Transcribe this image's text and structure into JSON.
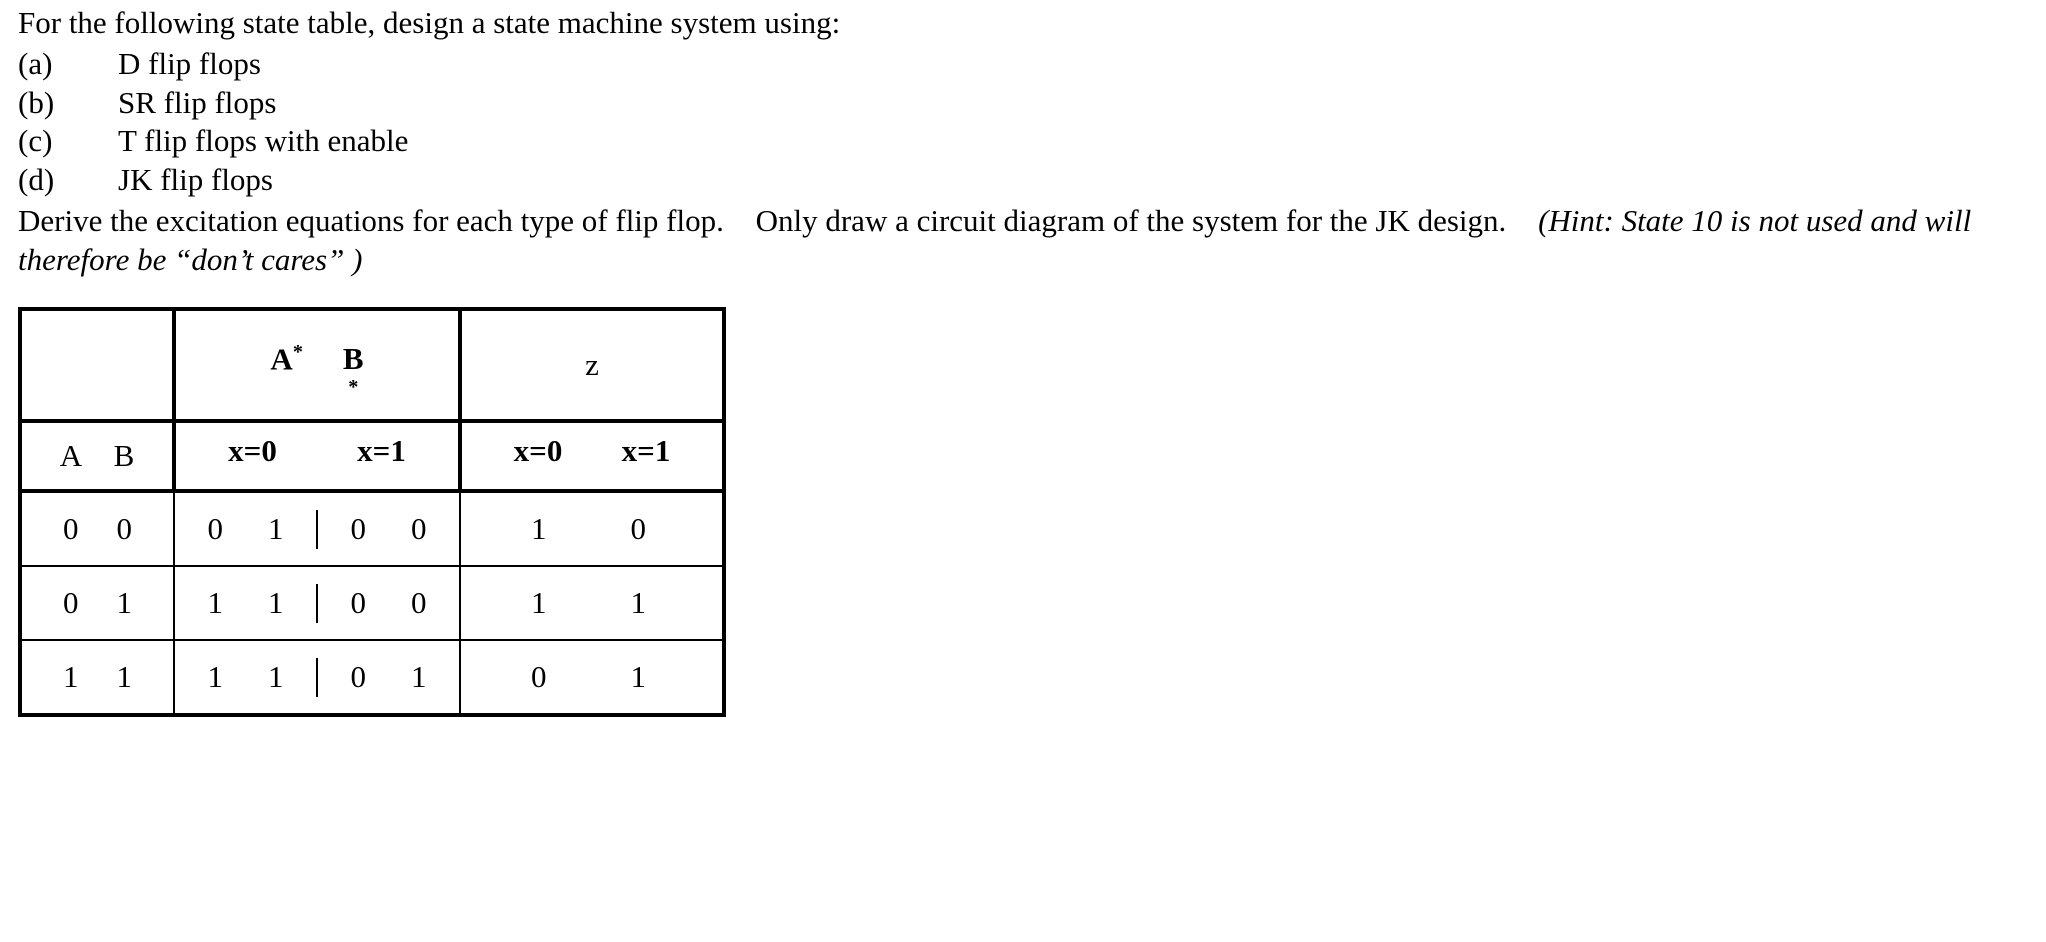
{
  "intro": "For the following state table, design a state machine system using:",
  "options": [
    {
      "label": "(a)",
      "text": "D flip flops"
    },
    {
      "label": "(b)",
      "text": "SR flip flops"
    },
    {
      "label": "(c)",
      "text": "T flip flops with enable"
    },
    {
      "label": "(d)",
      "text": "JK flip flops"
    }
  ],
  "instruction_part1": "Derive the excitation equations for each type of flip flop.",
  "instruction_part2": "Only draw a circuit diagram of the system for the JK design.",
  "hint": "(Hint: State 10 is not used and will therefore be “don’t cares” )",
  "headers": {
    "A_label": "A",
    "B_label": "B",
    "A_star": "A",
    "A_star_sup": "*",
    "B_sym": "B",
    "B_star_sub": "*",
    "z_label": "z",
    "x0": "x=0",
    "x1": "x=1"
  },
  "rows": [
    {
      "A": "0",
      "B": "0",
      "next_x0_A": "0",
      "next_x0_B": "1",
      "next_x1_A": "0",
      "next_x1_B": "0",
      "z_x0": "1",
      "z_x1": "0"
    },
    {
      "A": "0",
      "B": "1",
      "next_x0_A": "1",
      "next_x0_B": "1",
      "next_x1_A": "0",
      "next_x1_B": "0",
      "z_x0": "1",
      "z_x1": "1"
    },
    {
      "A": "1",
      "B": "1",
      "next_x0_A": "1",
      "next_x0_B": "1",
      "next_x1_A": "0",
      "next_x1_B": "1",
      "z_x0": "0",
      "z_x1": "1"
    }
  ]
}
